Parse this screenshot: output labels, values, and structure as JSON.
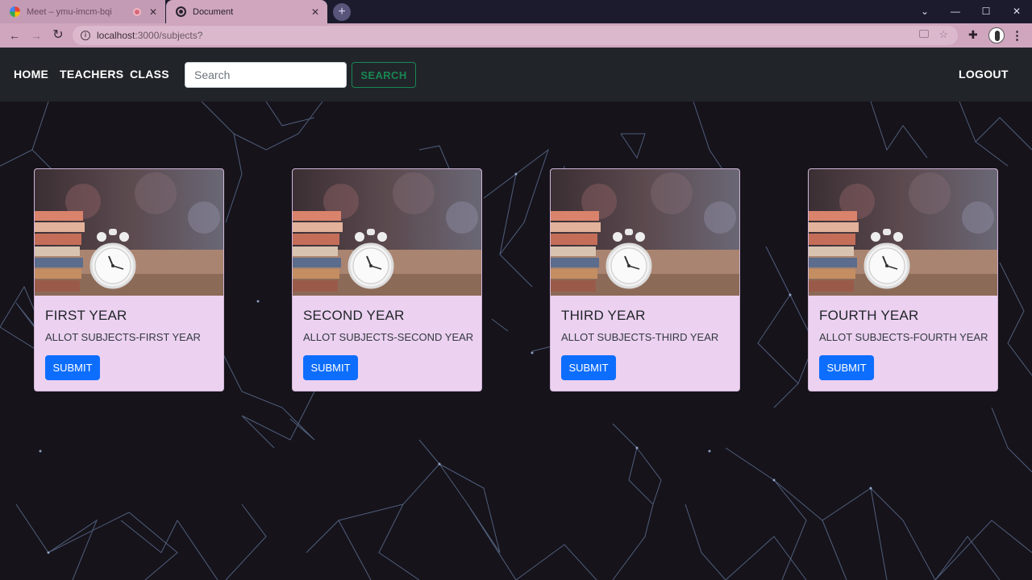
{
  "browser": {
    "tabs": [
      {
        "title": "Meet – ymu-imcm-bqi",
        "active": false
      },
      {
        "title": "Document",
        "active": true
      }
    ],
    "new_tab_label": "+",
    "address": {
      "host": "localhost",
      "path": ":3000/subjects?"
    },
    "controls": {
      "minimize": "—",
      "maximize": "☐",
      "close": "✕",
      "dropdown": "⌄"
    },
    "nav": {
      "back": "←",
      "forward": "→",
      "reload": "↻"
    }
  },
  "navbar": {
    "links": [
      "HOME",
      "TEACHERS",
      "CLASS"
    ],
    "search_placeholder": "Search",
    "search_button": "SEARCH",
    "logout": "LOGOUT"
  },
  "cards": [
    {
      "title": "FIRST YEAR",
      "text": "ALLOT SUBJECTS-FIRST YEAR",
      "button": "SUBMIT"
    },
    {
      "title": "SECOND YEAR",
      "text": "ALLOT SUBJECTS-SECOND YEAR",
      "button": "SUBMIT"
    },
    {
      "title": "THIRD YEAR",
      "text": "ALLOT SUBJECTS-THIRD YEAR",
      "button": "SUBMIT"
    },
    {
      "title": "FOURTH YEAR",
      "text": "ALLOT SUBJECTS-FOURTH YEAR",
      "button": "SUBMIT"
    }
  ],
  "colors": {
    "page_bg": "#16131b",
    "navbar_bg": "#212529",
    "card_bg": "#ecd1f1",
    "primary": "#0d6efd",
    "success": "#198754"
  }
}
